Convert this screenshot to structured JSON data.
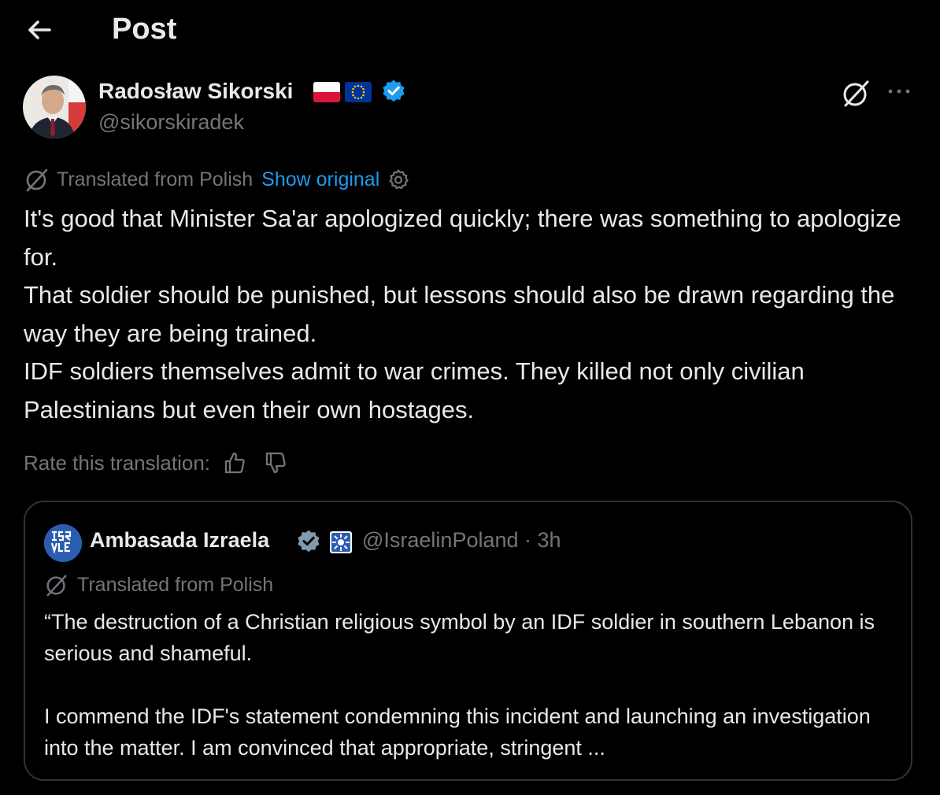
{
  "header": {
    "title": "Post",
    "back_icon": "arrow-left-icon"
  },
  "post": {
    "author_name": "Radosław Sikorski",
    "author_handle": "@sikorskiradek",
    "flags": [
      "poland-flag-icon",
      "eu-flag-icon"
    ],
    "verified_color": "#1d9bf0",
    "translated_label": "Translated from Polish",
    "show_original": "Show original",
    "text_lines": [
      "It's good that Minister Sa'ar apologized quickly; there was something to apologize for.",
      "That soldier should be punished, but lessons should also be drawn regarding the way they are being trained.",
      "IDF soldiers themselves admit to war crimes. They killed not only civilian Palestinians but even their own hostages."
    ],
    "rate_label": "Rate this translation:"
  },
  "quote": {
    "name": "Ambasada Izraela",
    "handle_time": "@IsraelinPoland · 3h",
    "translated_label": "Translated from Polish",
    "paragraph1": "“The destruction of a Christian religious symbol by an IDF soldier in southern Lebanon is serious and shameful.",
    "paragraph2": "I commend the IDF's statement condemning this incident and launching an investigation into the matter. I am convinced that appropriate, stringent ..."
  },
  "colors": {
    "background": "#000000",
    "text": "#e7e9ea",
    "muted": "#71767b",
    "accent": "#1d9bf0",
    "border": "#2f3336"
  }
}
